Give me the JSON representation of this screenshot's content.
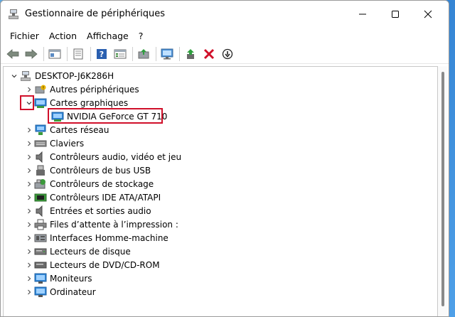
{
  "window": {
    "title": "Gestionnaire de périphériques"
  },
  "menu": [
    "Fichier",
    "Action",
    "Affichage",
    "?"
  ],
  "tree": {
    "root": "DESKTOP-J6K286H",
    "items": [
      {
        "label": "Autres périphériques",
        "icon": "unknown-device-icon",
        "expanded": false
      },
      {
        "label": "Cartes graphiques",
        "icon": "display-adapter-icon",
        "expanded": true,
        "children": [
          {
            "label": "NVIDIA GeForce GT 710",
            "icon": "display-adapter-icon"
          }
        ]
      },
      {
        "label": "Cartes réseau",
        "icon": "network-adapter-icon",
        "expanded": false
      },
      {
        "label": "Claviers",
        "icon": "keyboard-icon",
        "expanded": false
      },
      {
        "label": "Contrôleurs audio, vidéo et jeu",
        "icon": "speaker-icon",
        "expanded": false
      },
      {
        "label": "Contrôleurs de bus USB",
        "icon": "usb-icon",
        "expanded": false
      },
      {
        "label": "Contrôleurs de stockage",
        "icon": "storage-icon",
        "expanded": false
      },
      {
        "label": "Contrôleurs IDE ATA/ATAPI",
        "icon": "ide-icon",
        "expanded": false
      },
      {
        "label": "Entrées et sorties audio",
        "icon": "speaker-icon",
        "expanded": false
      },
      {
        "label": "Files d’attente à l’impression :",
        "icon": "printer-icon",
        "expanded": false
      },
      {
        "label": "Interfaces Homme-machine",
        "icon": "hid-icon",
        "expanded": false
      },
      {
        "label": "Lecteurs de disque",
        "icon": "disk-icon",
        "expanded": false
      },
      {
        "label": "Lecteurs de DVD/CD-ROM",
        "icon": "dvd-icon",
        "expanded": false
      },
      {
        "label": "Moniteurs",
        "icon": "monitor-icon",
        "expanded": false
      },
      {
        "label": "Ordinateur",
        "icon": "computer-icon",
        "expanded": false
      }
    ]
  },
  "colors": {
    "highlight": "#d0102a",
    "folder_blue": "#2f86d6"
  }
}
